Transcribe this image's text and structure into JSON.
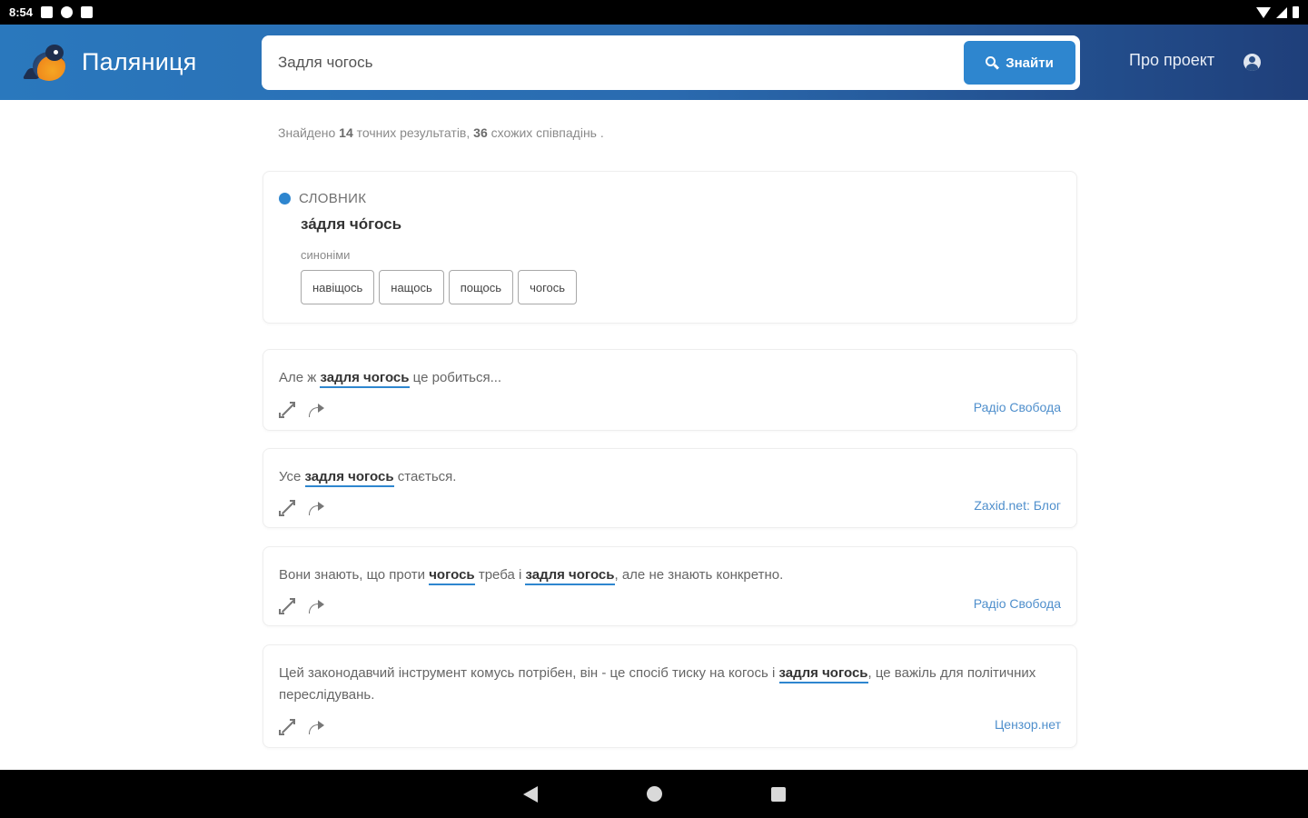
{
  "status_bar": {
    "time": "8:54"
  },
  "header": {
    "app_name": "Паляниця",
    "search": {
      "value": "Задля чогось",
      "button_label": "Знайти"
    },
    "about_label": "Про проект"
  },
  "summary": {
    "prefix": "Знайдено ",
    "exact_count": "14",
    "middle": " точних результатів, ",
    "similar_count": "36",
    "suffix": " схожих співпадінь ."
  },
  "dictionary": {
    "tag": "СЛОВНИК",
    "headword": "за́для чо́гось",
    "synonyms_label": "синоніми",
    "synonyms": [
      "навіщось",
      "нащось",
      "пощось",
      "чогось"
    ]
  },
  "examples": [
    {
      "parts": [
        "Але ж ",
        "задля чогось",
        " це робиться..."
      ],
      "source": "Радіо Свобода"
    },
    {
      "parts": [
        "Усе ",
        "задля чогось",
        " стається."
      ],
      "source": "Zaxid.net: Блог"
    },
    {
      "parts": [
        "Вони знають, що проти ",
        "чогось",
        " треба і ",
        "задля чогось",
        ", але не знають конкретно."
      ],
      "source": "Радіо Свобода"
    },
    {
      "parts": [
        "Цей законодавчий інструмент комусь потрібен, він - це спосіб тиску на когось і ",
        "задля чогось",
        ", це важіль для політичних переслідувань."
      ],
      "source": "Цензор.нет"
    }
  ],
  "colors": {
    "accent": "#2e86cf",
    "header_start": "#2a78bd",
    "header_end": "#1f3f7a"
  }
}
